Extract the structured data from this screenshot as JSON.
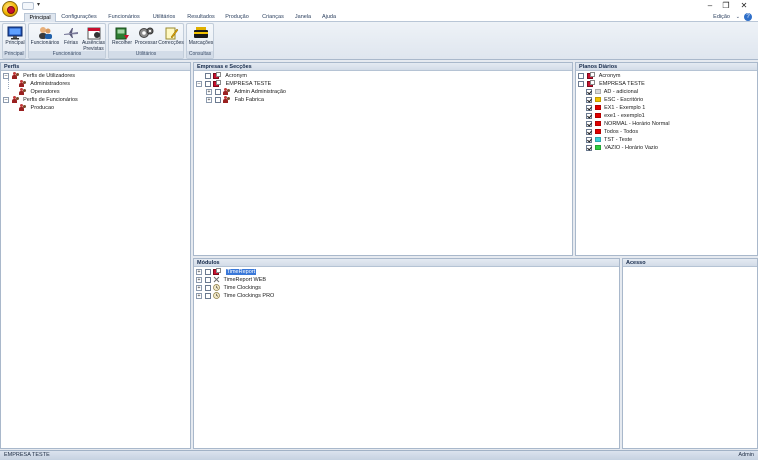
{
  "window": {
    "qat_arrow": "▾",
    "controls": {
      "minimize": "–",
      "maximize": "❐",
      "close": "✕"
    }
  },
  "tabs": [
    "Principal",
    "Configurações",
    "Funcionários",
    "Utilitários",
    "Resultados",
    "Produção",
    "Crianças",
    "Janela",
    "Ajuda"
  ],
  "edit_menu": "Edição",
  "ribbon_minimize": "⌄",
  "help_label": "?",
  "ribbon": {
    "groups": [
      {
        "label": "Principal",
        "buttons": [
          {
            "label": "Principal"
          }
        ]
      },
      {
        "label": "Funcionários",
        "buttons": [
          {
            "label": "Funcionários"
          },
          {
            "label": "Férias"
          },
          {
            "label": "Ausências Previstas"
          }
        ]
      },
      {
        "label": "Utilitários",
        "buttons": [
          {
            "label": "Recolher"
          },
          {
            "label": "Processar"
          },
          {
            "label": "Correcções"
          }
        ]
      },
      {
        "label": "Consultas",
        "buttons": [
          {
            "label": "Marcações"
          }
        ]
      }
    ]
  },
  "perfis": {
    "title": "Perfis",
    "items": [
      {
        "label": "Perfis de Utilizadores"
      },
      {
        "label": "Administradores"
      },
      {
        "label": "Operadores"
      },
      {
        "label": "Perfis de Funcionários"
      },
      {
        "label": "Producao"
      }
    ]
  },
  "empresas": {
    "title": "Empresas e Secções",
    "items": [
      {
        "label": "Acronym"
      },
      {
        "label": "EMPRESA TESTE"
      },
      {
        "label": "Admin  Administração"
      },
      {
        "label": "Fab  Fabrica"
      }
    ]
  },
  "planos": {
    "title": "Planos Diários",
    "items": [
      {
        "label": "Acronym"
      },
      {
        "label": "EMPRESA TESTE"
      },
      {
        "label": "AD - adicional",
        "color": "#d9d9d9"
      },
      {
        "label": "ESC - Escritório",
        "color": "#f2c200"
      },
      {
        "label": "EX1 - Exemplo 1",
        "color": "#e00000"
      },
      {
        "label": "exe1 - exemplo1",
        "color": "#e00000"
      },
      {
        "label": "NORMAL - Horário Normal",
        "color": "#e00000"
      },
      {
        "label": "Todos - Todos",
        "color": "#e00000"
      },
      {
        "label": "TST - Teste",
        "color": "#3ad0d8"
      },
      {
        "label": "VAZIO - Horário Vazio",
        "color": "#2ecc40"
      }
    ]
  },
  "modulos": {
    "title": "Módulos",
    "items": [
      {
        "label": "TimeReport"
      },
      {
        "label": "TimeReport WEB"
      },
      {
        "label": "Time Clockings"
      },
      {
        "label": "Time Clockings PRO"
      }
    ]
  },
  "acesso": {
    "title": "Acesso"
  },
  "status": {
    "left": "EMPRESA TESTE",
    "right": "Admin"
  }
}
